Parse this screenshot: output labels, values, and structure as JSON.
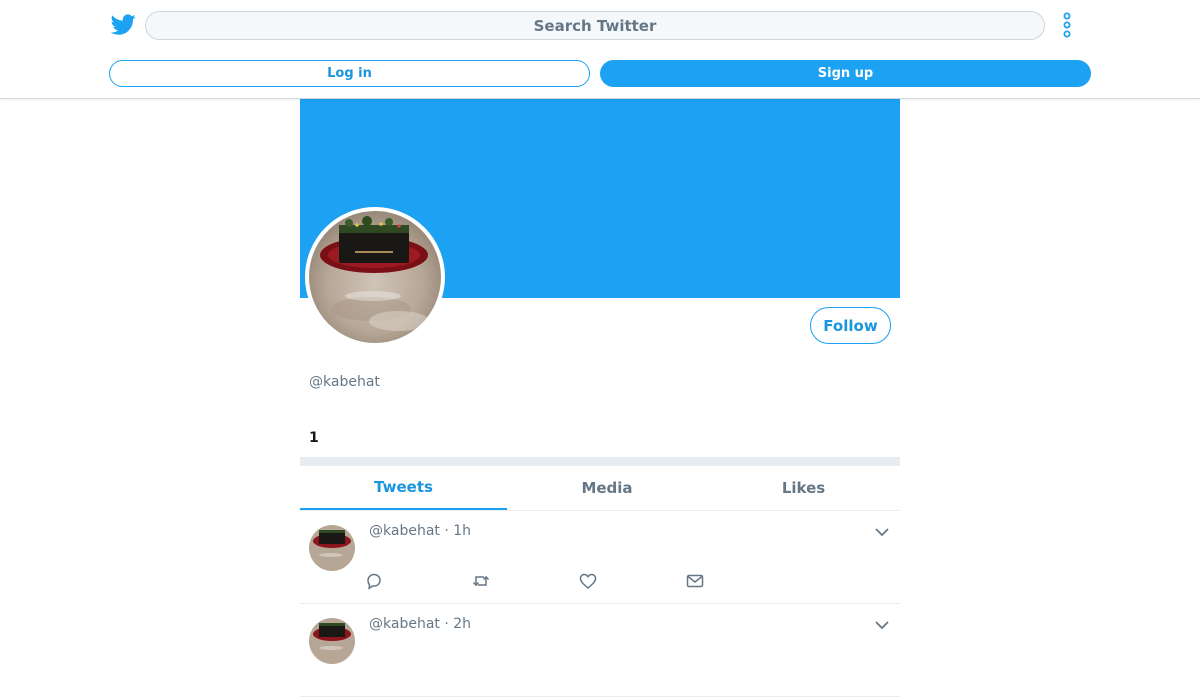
{
  "header": {
    "logo_icon": "twitter-bird-icon",
    "search_placeholder": "Search Twitter",
    "more_icon": "more-vertical-icon",
    "login_label": "Log in",
    "signup_label": "Sign up"
  },
  "profile": {
    "banner_color": "#1DA1F2",
    "follow_label": "Follow",
    "handle": "@kabehat",
    "stat_count": "1"
  },
  "tabs": [
    {
      "label": "Tweets",
      "active": true
    },
    {
      "label": "Media",
      "active": false
    },
    {
      "label": "Likes",
      "active": false
    }
  ],
  "tweets": [
    {
      "meta": "@kabehat · 1h"
    },
    {
      "meta": "@kabehat · 2h"
    }
  ],
  "colors": {
    "accent": "#1DA1F2",
    "accent_text": "#1B95E0",
    "muted_text": "#657786"
  }
}
